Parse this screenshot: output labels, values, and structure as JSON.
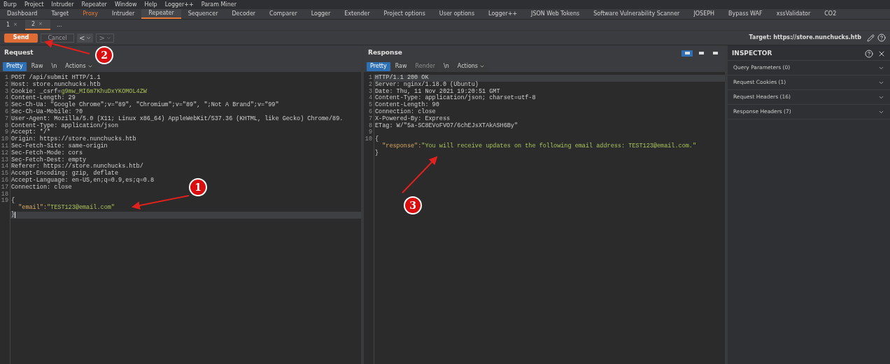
{
  "menu": [
    "Burp",
    "Project",
    "Intruder",
    "Repeater",
    "Window",
    "Help",
    "Logger++",
    "Param Miner"
  ],
  "tabs": [
    {
      "label": "Dashboard",
      "selected": false,
      "highlighted": false
    },
    {
      "label": "Target",
      "selected": false,
      "highlighted": false
    },
    {
      "label": "Proxy",
      "selected": false,
      "highlighted": true
    },
    {
      "label": "Intruder",
      "selected": false,
      "highlighted": false
    },
    {
      "label": "Repeater",
      "selected": true,
      "highlighted": false
    },
    {
      "label": "Sequencer",
      "selected": false,
      "highlighted": false
    },
    {
      "label": "Decoder",
      "selected": false,
      "highlighted": false
    },
    {
      "label": "Comparer",
      "selected": false,
      "highlighted": false
    },
    {
      "label": "Logger",
      "selected": false,
      "highlighted": false
    },
    {
      "label": "Extender",
      "selected": false,
      "highlighted": false
    },
    {
      "label": "Project options",
      "selected": false,
      "highlighted": false
    },
    {
      "label": "User options",
      "selected": false,
      "highlighted": false
    },
    {
      "label": "Logger++",
      "selected": false,
      "highlighted": false
    },
    {
      "label": "JSON Web Tokens",
      "selected": false,
      "highlighted": false
    },
    {
      "label": "Software Vulnerability Scanner",
      "selected": false,
      "highlighted": false
    },
    {
      "label": "JOSEPH",
      "selected": false,
      "highlighted": false
    },
    {
      "label": "Bypass WAF",
      "selected": false,
      "highlighted": false
    },
    {
      "label": "xssValidator",
      "selected": false,
      "highlighted": false
    },
    {
      "label": "CO2",
      "selected": false,
      "highlighted": false
    }
  ],
  "subtabs": [
    {
      "label": "1",
      "close": "×",
      "selected": false
    },
    {
      "label": "2",
      "close": "×",
      "selected": true
    },
    {
      "label": "...",
      "selected": false
    }
  ],
  "toolbar": {
    "send": "Send",
    "cancel": "Cancel",
    "cancel_disabled": true,
    "back": "<",
    "forward": ">",
    "target": "Target: https://store.nunchucks.htb"
  },
  "request": {
    "title": "Request",
    "view_tabs": [
      {
        "label": "Pretty",
        "selected": true,
        "disabled": false
      },
      {
        "label": "Raw",
        "selected": false,
        "disabled": false
      },
      {
        "label": "\\n",
        "selected": false,
        "disabled": false
      }
    ],
    "actions": "Actions",
    "lines": [
      {
        "num": "1",
        "highlighted": false,
        "segments": [
          {
            "kind": "plain",
            "text": "POST /api/submit HTTP/1.1"
          }
        ]
      },
      {
        "num": "2",
        "highlighted": false,
        "segments": [
          {
            "kind": "plain",
            "text": "Host: store.nunchucks.htb"
          }
        ]
      },
      {
        "num": "3",
        "highlighted": false,
        "segments": [
          {
            "kind": "plain",
            "text": "Cookie: _csrf="
          },
          {
            "kind": "string",
            "text": "g9mw_MI6m7KhuDxYKOMOL4ZW"
          }
        ]
      },
      {
        "num": "4",
        "highlighted": false,
        "segments": [
          {
            "kind": "plain",
            "text": "Content-Length: 29"
          }
        ]
      },
      {
        "num": "5",
        "highlighted": false,
        "segments": [
          {
            "kind": "plain",
            "text": "Sec-Ch-Ua: \"Google Chrome\";v=\"89\", \"Chromium\";v=\"89\", \";Not A Brand\";v=\"99\""
          }
        ]
      },
      {
        "num": "6",
        "highlighted": false,
        "segments": [
          {
            "kind": "plain",
            "text": "Sec-Ch-Ua-Mobile: ?0"
          }
        ]
      },
      {
        "num": "7",
        "highlighted": false,
        "segments": [
          {
            "kind": "plain",
            "text": "User-Agent: Mozilla/5.0 (X11; Linux x86_64) AppleWebKit/537.36 (KHTML, like Gecko) Chrome/89."
          }
        ]
      },
      {
        "num": "8",
        "highlighted": false,
        "segments": [
          {
            "kind": "plain",
            "text": "Content-Type: application/json"
          }
        ]
      },
      {
        "num": "9",
        "highlighted": false,
        "segments": [
          {
            "kind": "plain",
            "text": "Accept: */*"
          }
        ]
      },
      {
        "num": "10",
        "highlighted": false,
        "segments": [
          {
            "kind": "plain",
            "text": "Origin: https://store.nunchucks.htb"
          }
        ]
      },
      {
        "num": "11",
        "highlighted": false,
        "segments": [
          {
            "kind": "plain",
            "text": "Sec-Fetch-Site: same-origin"
          }
        ]
      },
      {
        "num": "12",
        "highlighted": false,
        "segments": [
          {
            "kind": "plain",
            "text": "Sec-Fetch-Mode: cors"
          }
        ]
      },
      {
        "num": "13",
        "highlighted": false,
        "segments": [
          {
            "kind": "plain",
            "text": "Sec-Fetch-Dest: empty"
          }
        ]
      },
      {
        "num": "14",
        "highlighted": false,
        "segments": [
          {
            "kind": "plain",
            "text": "Referer: https://store.nunchucks.htb/"
          }
        ]
      },
      {
        "num": "15",
        "highlighted": false,
        "segments": [
          {
            "kind": "plain",
            "text": "Accept-Encoding: gzip, deflate"
          }
        ]
      },
      {
        "num": "16",
        "highlighted": false,
        "segments": [
          {
            "kind": "plain",
            "text": "Accept-Language: en-US,en;q=0.9,es;q=0.8"
          }
        ]
      },
      {
        "num": "17",
        "highlighted": false,
        "segments": [
          {
            "kind": "plain",
            "text": "Connection: close"
          }
        ]
      },
      {
        "num": "18",
        "highlighted": false
      },
      {
        "num": "19",
        "highlighted": false,
        "segments": [
          {
            "kind": "plain",
            "text": "{"
          }
        ]
      },
      {
        "highlighted": false,
        "segments": [
          {
            "kind": "key",
            "text": "  \"email\":"
          },
          {
            "kind": "string",
            "text": "\"TEST123@email.com\""
          }
        ]
      },
      {
        "highlighted": true,
        "cursor": true,
        "segments": [
          {
            "kind": "plain",
            "text": "}"
          }
        ]
      }
    ]
  },
  "response": {
    "title": "Response",
    "view_tabs": [
      {
        "label": "Pretty",
        "selected": true,
        "disabled": false
      },
      {
        "label": "Raw",
        "selected": false,
        "disabled": false
      },
      {
        "label": "Render",
        "selected": false,
        "disabled": true
      },
      {
        "label": "\\n",
        "selected": false,
        "disabled": false
      }
    ],
    "actions": "Actions",
    "layout_buttons": [
      {
        "selected": true
      },
      {
        "selected": false
      },
      {
        "selected": false
      }
    ],
    "lines": [
      {
        "num": "1",
        "highlighted": true,
        "segments": [
          {
            "kind": "plain",
            "text": "HTTP/1.1 200 OK"
          }
        ]
      },
      {
        "num": "2",
        "highlighted": false,
        "segments": [
          {
            "kind": "plain",
            "text": "Server: nginx/1.18.0 (Ubuntu)"
          }
        ]
      },
      {
        "num": "3",
        "highlighted": false,
        "segments": [
          {
            "kind": "plain",
            "text": "Date: Thu, 11 Nov 2021 19:20:51 GMT"
          }
        ]
      },
      {
        "num": "4",
        "highlighted": false,
        "segments": [
          {
            "kind": "plain",
            "text": "Content-Type: application/json; charset=utf-8"
          }
        ]
      },
      {
        "num": "5",
        "highlighted": false,
        "segments": [
          {
            "kind": "plain",
            "text": "Content-Length: 90"
          }
        ]
      },
      {
        "num": "6",
        "highlighted": false,
        "segments": [
          {
            "kind": "plain",
            "text": "Connection: close"
          }
        ]
      },
      {
        "num": "7",
        "highlighted": false,
        "segments": [
          {
            "kind": "plain",
            "text": "X-Powered-By: Express"
          }
        ]
      },
      {
        "num": "8",
        "highlighted": false,
        "segments": [
          {
            "kind": "plain",
            "text": "ETag: W/\"5a-SC8EVoFVO7/6chEJsXTAkASH6By\""
          }
        ]
      },
      {
        "num": "9",
        "highlighted": false
      },
      {
        "num": "10",
        "highlighted": false,
        "segments": [
          {
            "kind": "plain",
            "text": "{"
          }
        ]
      },
      {
        "highlighted": false,
        "segments": [
          {
            "kind": "key",
            "text": "  \"response\":"
          },
          {
            "kind": "string",
            "text": "\"You will receive updates on the following email address: TEST123@email.com.\""
          }
        ]
      },
      {
        "highlighted": false,
        "segments": [
          {
            "kind": "plain",
            "text": "}"
          }
        ]
      }
    ]
  },
  "inspector": {
    "title": "INSPECTOR",
    "sections": [
      {
        "label": "Query Parameters (0)",
        "expanded": false
      },
      {
        "label": "Request Cookies (1)",
        "expanded": false
      },
      {
        "label": "Request Headers (16)",
        "expanded": false
      },
      {
        "label": "Response Headers (7)",
        "expanded": false
      }
    ]
  },
  "annotations": [
    {
      "label": "1"
    },
    {
      "label": "2"
    },
    {
      "label": "3"
    }
  ]
}
